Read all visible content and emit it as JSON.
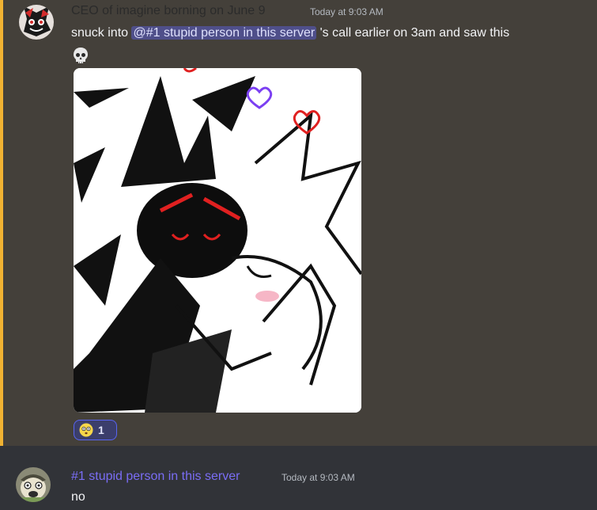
{
  "messages": [
    {
      "author": "CEO of imagine borning on June 9",
      "author_color": "#2b2b2b",
      "timestamp": "Today at 9:03 AM",
      "text_before": "snuck into ",
      "mention": "@#1 stupid person in this server",
      "text_after": " 's call earlier on 3am and saw this",
      "emoji_icon": "skull-icon",
      "attachment_icon": "fanart-image",
      "reaction": {
        "emoji_icon": "dizzy-face-icon",
        "count": "1"
      }
    },
    {
      "author": "#1 stupid person in this server",
      "author_color": "#7a6df5",
      "timestamp": "Today at 9:03 AM",
      "text": "no"
    }
  ],
  "colors": {
    "highlight_bg": "#44403a",
    "highlight_bar": "#f0b232",
    "mention_bg": "#4f4f8a",
    "reaction_border": "#5865f2"
  }
}
